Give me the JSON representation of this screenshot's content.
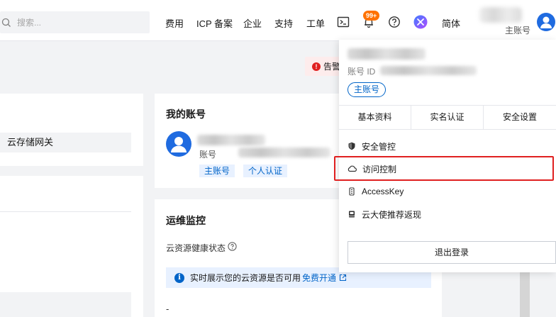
{
  "topbar": {
    "search_placeholder": "搜索...",
    "nav": [
      "费用",
      "ICP 备案",
      "企业",
      "支持",
      "工单"
    ],
    "notification_badge": "99+",
    "language": "简体",
    "account_role": "主账号"
  },
  "alert": {
    "label": "告警"
  },
  "left_panel": {
    "storage_gateway": "云存储网关"
  },
  "my_account": {
    "title": "我的账号",
    "account_label": "账号",
    "tags": [
      "主账号",
      "个人认证"
    ]
  },
  "monitoring": {
    "title": "运维监控",
    "health_label": "云资源健康状态",
    "info_text": "实时展示您的云资源是否可用",
    "info_link": "免费开通",
    "placeholder_dash": "-"
  },
  "popover": {
    "account_id_label": "账号 ID",
    "role_tag": "主账号",
    "tabs": [
      "基本资料",
      "实名认证",
      "安全设置"
    ],
    "menu": [
      {
        "label": "安全管控",
        "icon": "shield-icon"
      },
      {
        "label": "访问控制",
        "icon": "cloud-icon"
      },
      {
        "label": "AccessKey",
        "icon": "key-icon"
      },
      {
        "label": "云大使推荐返现",
        "icon": "gift-icon"
      }
    ],
    "logout": "退出登录"
  },
  "colors": {
    "accent": "#0064c8",
    "highlight": "#e02020",
    "badge": "#ff7200"
  }
}
